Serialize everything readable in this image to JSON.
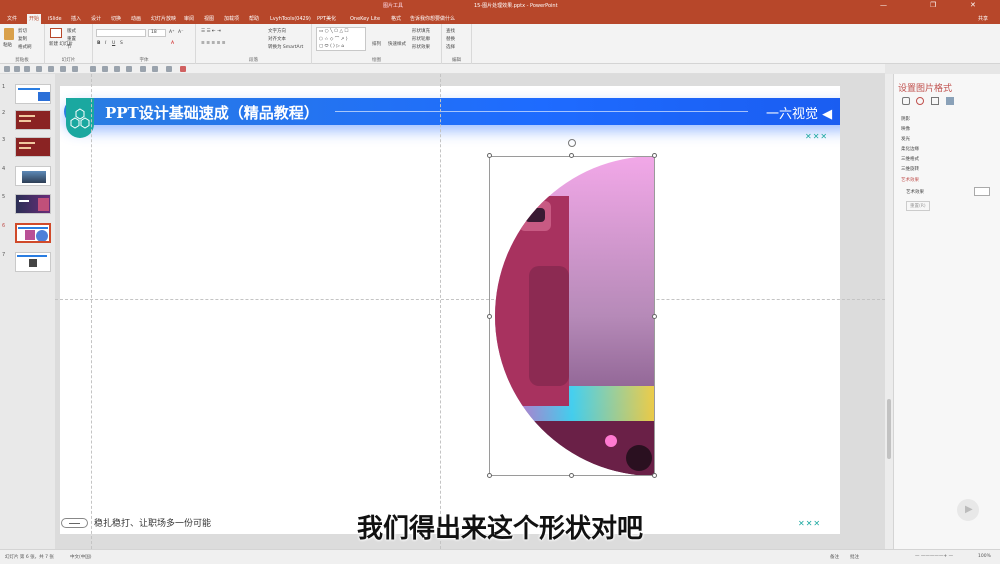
{
  "titlebar": {
    "context_tab": "图片工具",
    "doc_title": "15-图片处理效果.pptx - PowerPoint",
    "minimize": "—",
    "restore": "❐",
    "close": "✕"
  },
  "tabs": [
    "文件",
    "开始",
    "iSlide",
    "插入",
    "设计",
    "切换",
    "动画",
    "幻灯片放映",
    "审阅",
    "视图",
    "加载项",
    "帮助",
    "LvyhTools(0429)",
    "PPT美化",
    "OneKey Lite",
    "格式"
  ],
  "tell_me": "告诉我你想要做什么",
  "share": "共享",
  "ribbon": {
    "groups": [
      "剪贴板",
      "幻灯片",
      "字体",
      "段落",
      "绘图",
      "编辑"
    ],
    "paste": "粘贴",
    "cut": "剪切",
    "copy": "复制",
    "format_painter": "格式刷",
    "new_slide": "新建\n幻灯片",
    "layout": "版式",
    "reset": "重置",
    "section": "节",
    "font_size": "18",
    "text_direction": "文字方向",
    "align_text": "对齐文本",
    "smartart": "转换为 SmartArt",
    "arrange": "排列",
    "quick_styles": "快速样式",
    "shape_fill": "形状填充",
    "shape_outline": "形状轮廓",
    "shape_effects": "形状效果",
    "find": "查找",
    "replace": "替换",
    "select": "选择"
  },
  "thumbnails": [
    {
      "n": "1"
    },
    {
      "n": "2"
    },
    {
      "n": "3"
    },
    {
      "n": "4"
    },
    {
      "n": "5"
    },
    {
      "n": "6"
    },
    {
      "n": "7"
    }
  ],
  "slide": {
    "banner_title": "PPT设计基础速成（精品教程）",
    "banner_right": "一六视觉 ◀",
    "marks": "✕✕✕",
    "footer_text": "稳扎稳打、让职场多一份可能"
  },
  "caption": "我们得出来这个形状对吧",
  "pane": {
    "title": "设置图片格式",
    "items": [
      "阴影",
      "映像",
      "发光",
      "柔化边缘",
      "三维格式",
      "三维旋转",
      "艺术效果"
    ],
    "art_label": "艺术效果",
    "reset": "重置(R)"
  },
  "status": {
    "slide_info": "幻灯片 第 6 张，共 7 张",
    "lang": "中文(中国)",
    "notes": "备注",
    "comments": "批注",
    "zoom": "100%"
  },
  "colors": {
    "accent": "#b7472a",
    "banner": "#1e6bff",
    "teal": "#1aa8a0"
  }
}
